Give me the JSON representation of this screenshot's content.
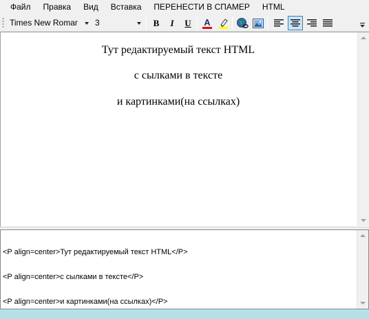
{
  "menu": {
    "file": "Файл",
    "edit": "Правка",
    "view": "Вид",
    "insert": "Вставка",
    "transfer": "ПЕРЕНЕСТИ В СПАМЕР",
    "html": "HTML"
  },
  "toolbar": {
    "font_name": "Times New Romar",
    "font_size": "3",
    "bold": "B",
    "italic": "I",
    "underline": "U",
    "font_color_letter": "A",
    "font_color": "#e01010",
    "highlight_color": "#ffff00",
    "active_alignment": "center",
    "icons": [
      "grip-icon",
      "font-dropdown",
      "size-dropdown",
      "bold",
      "italic",
      "underline",
      "font-color-icon",
      "highlighter-icon",
      "link-icon",
      "image-icon",
      "align-left-icon",
      "align-center-icon",
      "align-right-icon",
      "justify-icon",
      "toolbar-overflow-icon"
    ]
  },
  "editor": {
    "lines": [
      "Тут редактируемый текст HTML",
      "с сылками в тексте",
      "и картинками(на ссылках)"
    ]
  },
  "source": {
    "lines": [
      "<P align=center>Тут редактируемый текст HTML</P>",
      "<P align=center>с сылками в тексте</P>",
      "<P align=center>и картинками(на ссылках)</P>"
    ]
  }
}
